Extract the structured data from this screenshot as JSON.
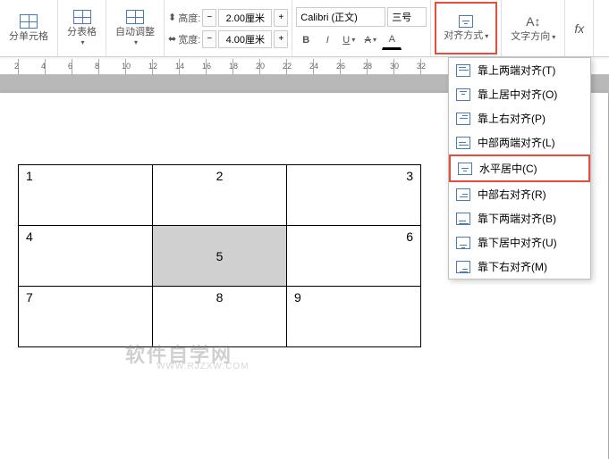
{
  "ribbon": {
    "split_cell": "分单元格",
    "split_table": "分表格",
    "auto_fit": "自动调整",
    "height_label": "高度:",
    "height_value": "2.00厘米",
    "width_label": "宽度:",
    "width_value": "4.00厘米",
    "font_name": "Calibri (正文)",
    "font_size": "三号",
    "bold": "B",
    "italic": "I",
    "underline": "U",
    "strike": "A",
    "align_btn": "对齐方式",
    "text_dir": "文字方向",
    "fx": "fx"
  },
  "ruler": {
    "ticks": [
      "2",
      "4",
      "6",
      "8",
      "10",
      "12",
      "14",
      "16",
      "18",
      "20",
      "22",
      "24",
      "26",
      "28",
      "30",
      "32"
    ]
  },
  "table": {
    "cells": [
      "1",
      "2",
      "3",
      "4",
      "5",
      "6",
      "7",
      "8",
      "9"
    ]
  },
  "align_menu": {
    "items": [
      {
        "label": "靠上两端对齐(T)",
        "icon": "ico-tl"
      },
      {
        "label": "靠上居中对齐(O)",
        "icon": "ico-tc"
      },
      {
        "label": "靠上右对齐(P)",
        "icon": "ico-tr"
      },
      {
        "label": "中部两端对齐(L)",
        "icon": "ico-ml"
      },
      {
        "label": "水平居中(C)",
        "icon": "ico-mc",
        "hilite": true
      },
      {
        "label": "中部右对齐(R)",
        "icon": "ico-mr"
      },
      {
        "label": "靠下两端对齐(B)",
        "icon": "ico-bl"
      },
      {
        "label": "靠下居中对齐(U)",
        "icon": "ico-bc"
      },
      {
        "label": "靠下右对齐(M)",
        "icon": "ico-br"
      }
    ]
  },
  "watermark": {
    "main": "软件自学网",
    "sub": "WWW.RJZXW.COM"
  }
}
